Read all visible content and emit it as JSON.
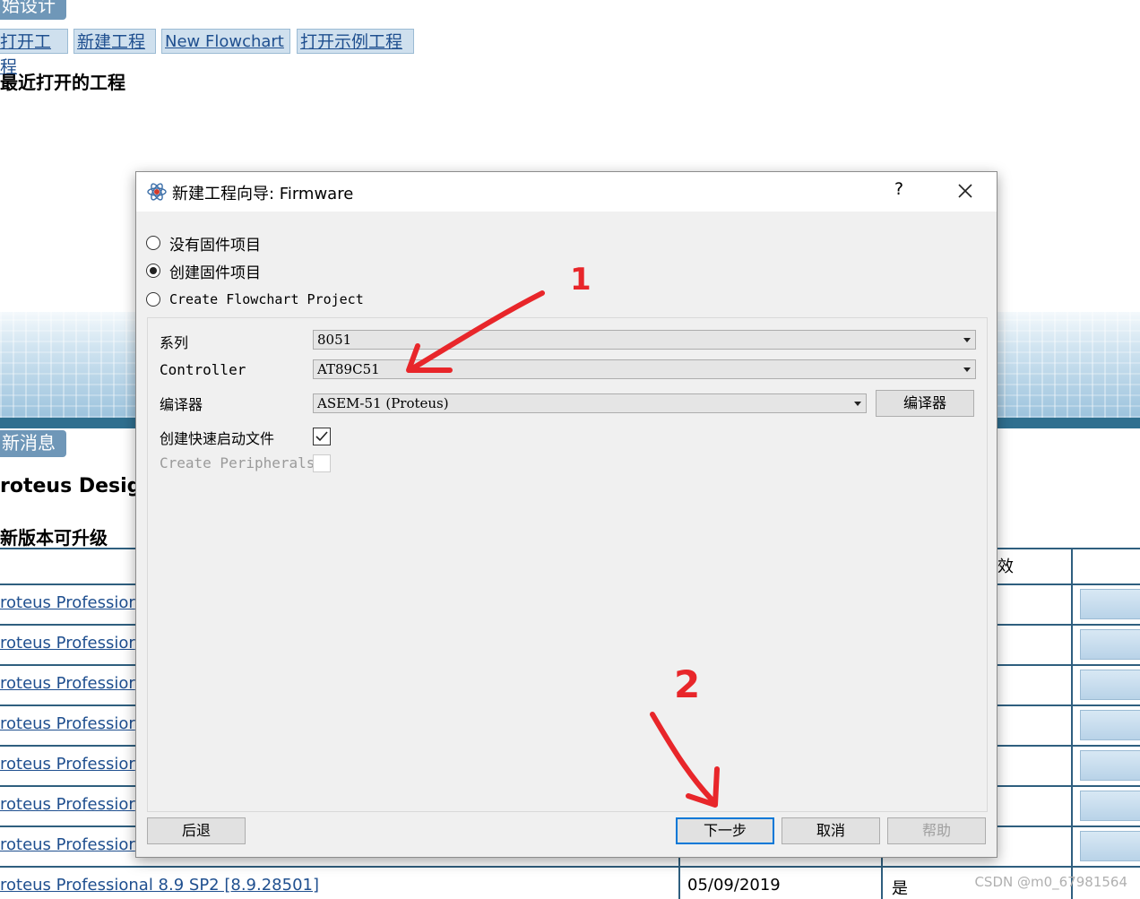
{
  "start_page": {
    "design_tab": "始设计",
    "links": [
      "打开工程",
      "新建工程",
      "New Flowchart",
      "打开示例工程"
    ],
    "recent_title": "最近打开的工程",
    "news_tab": "新消息",
    "news_heading": "roteus Design",
    "upgrade_title": "新版本可升级",
    "col_header_valid": "效",
    "rows": [
      {
        "name": "roteus Professior"
      },
      {
        "name": "roteus Professior"
      },
      {
        "name": "roteus Professior"
      },
      {
        "name": "roteus Professior"
      },
      {
        "name": "roteus Professior"
      },
      {
        "name": "roteus Professior"
      },
      {
        "name": "roteus Professior"
      },
      {
        "name": "roteus Professional 8.9 SP2 [8.9.28501]",
        "date": "05/09/2019",
        "valid": "是"
      }
    ]
  },
  "dialog": {
    "title": "新建工程向导: Firmware",
    "help_glyph": "?",
    "radios": [
      {
        "label": "没有固件项目",
        "checked": false
      },
      {
        "label": "创建固件项目",
        "checked": true
      },
      {
        "label": "Create Flowchart Project",
        "checked": false
      }
    ],
    "fields": {
      "family_label": "系列",
      "family_value": "8051",
      "controller_label": "Controller",
      "controller_value": "AT89C51",
      "compiler_label": "编译器",
      "compiler_value": "ASEM-51 (Proteus)",
      "compiler_button": "编译器",
      "quickstart_label": "创建快速启动文件",
      "quickstart_checked": true,
      "peripherals_label": "Create Peripherals",
      "peripherals_checked": false
    },
    "buttons": {
      "back": "后退",
      "next": "下一步",
      "cancel": "取消",
      "help": "帮助"
    }
  },
  "annotations": {
    "marker_1": "1",
    "marker_2": "2",
    "color": "#e8262a"
  },
  "watermark": "CSDN @m0_67981564"
}
